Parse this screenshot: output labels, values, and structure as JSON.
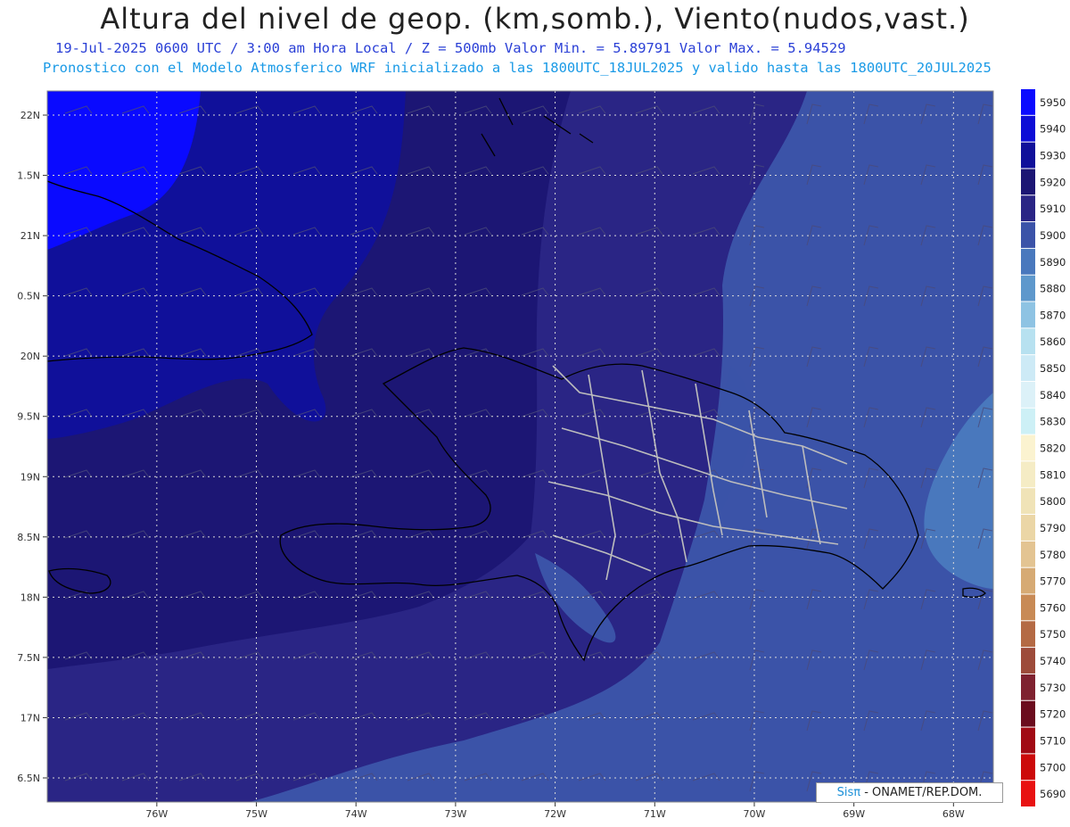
{
  "title": "Altura del nivel de geop. (km,somb.), Viento(nudos,vast.)",
  "subtitle_1": "19-Jul-2025   0600 UTC / 3:00 am Hora Local / Z = 500mb     Valor Min. = 5.89791  Valor Max. = 5.94529",
  "subtitle_2": "Pronostico con el Modelo Atmosferico WRF inicializado a las 1800UTC_18JUL2025 y valido hasta las  1800UTC_20JUL2025",
  "credit": {
    "brand": "Sisπ",
    "text": "- ONAMET/REP.DOM."
  },
  "lat_labels": [
    "22N",
    "1.5N",
    "21N",
    "0.5N",
    "20N",
    "9.5N",
    "19N",
    "8.5N",
    "18N",
    "7.5N",
    "17N",
    "6.5N"
  ],
  "lat_values": [
    22,
    21.5,
    21,
    20.5,
    20,
    19.5,
    19,
    18.5,
    18,
    17.5,
    17,
    16.5
  ],
  "lon_labels": [
    "76W",
    "75W",
    "74W",
    "73W",
    "72W",
    "71W",
    "70W",
    "69W",
    "68W"
  ],
  "lon_values": [
    -76,
    -75,
    -74,
    -73,
    -72,
    -71,
    -70,
    -69,
    -68
  ],
  "extent": {
    "lon_min": -77.1,
    "lon_max": -67.6,
    "lat_min": 16.3,
    "lat_max": 22.2
  },
  "legend": {
    "levels": [
      5950,
      5940,
      5930,
      5920,
      5910,
      5900,
      5890,
      5880,
      5870,
      5860,
      5850,
      5840,
      5830,
      5820,
      5810,
      5800,
      5790,
      5780,
      5770,
      5760,
      5750,
      5740,
      5730,
      5720,
      5710,
      5700,
      5690
    ],
    "colors": [
      "#0a0aff",
      "#0d0dd6",
      "#10109a",
      "#1c1674",
      "#2a2585",
      "#3b53a8",
      "#4978bd",
      "#5e98cc",
      "#8ec3e3",
      "#b7e1f0",
      "#cdeaf6",
      "#dcf1f8",
      "#cdf0f6",
      "#fbf3d0",
      "#f5ecc5",
      "#f0e3b7",
      "#ebd6a6",
      "#e3c492",
      "#d6aa74",
      "#c88a55",
      "#b46a44",
      "#9d4b3a",
      "#7f2230",
      "#6b0c1e",
      "#a10a14",
      "#cc0a0a",
      "#e81212"
    ]
  }
}
